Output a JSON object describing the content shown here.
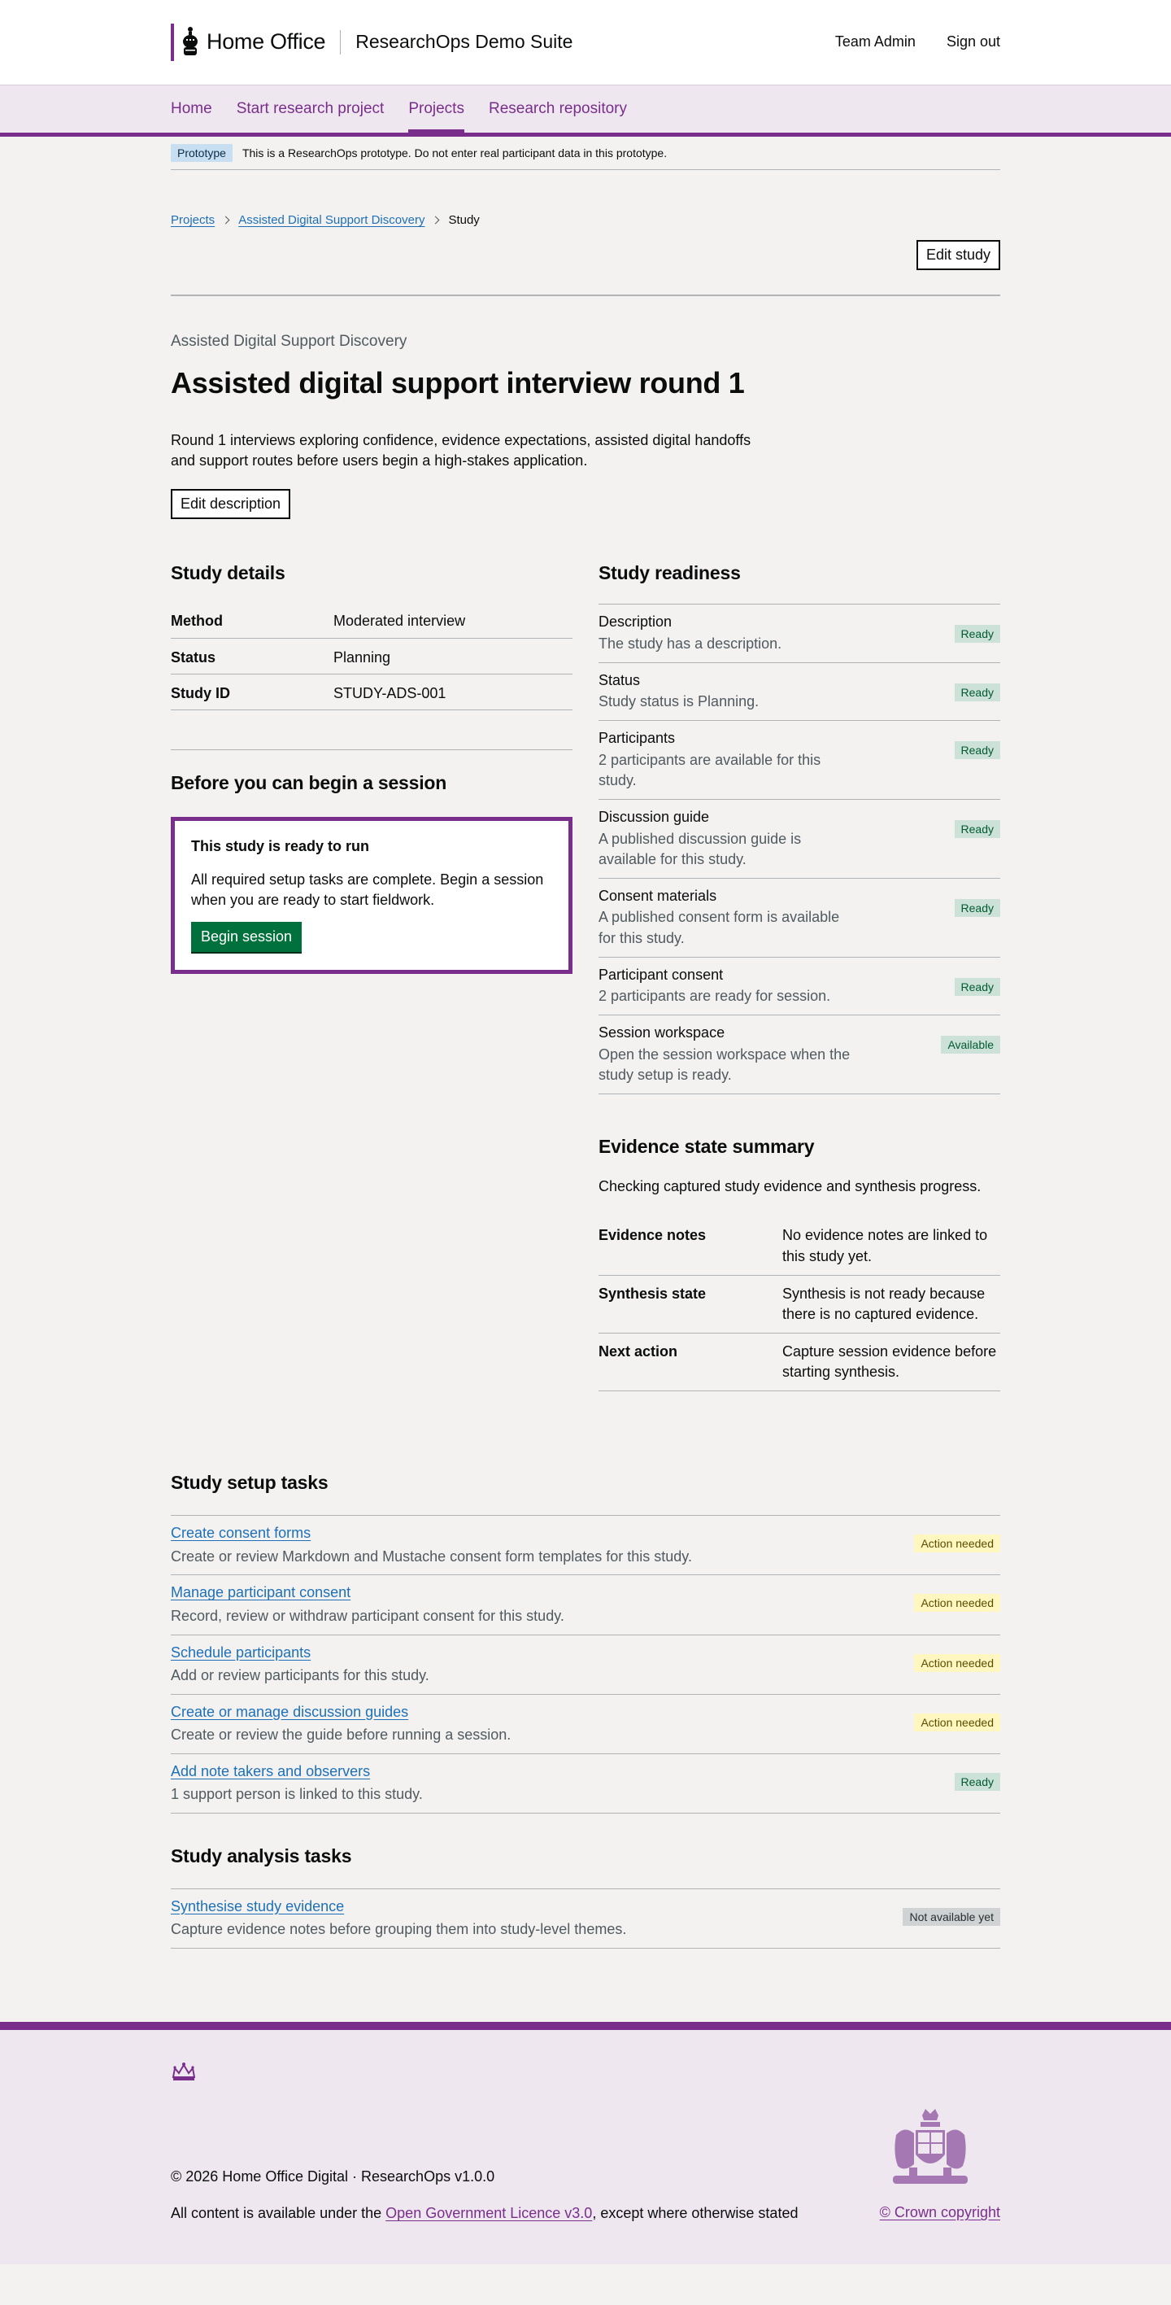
{
  "header": {
    "org": "Home Office",
    "service": "ResearchOps Demo Suite",
    "links": [
      "Team Admin",
      "Sign out"
    ]
  },
  "nav": {
    "items": [
      {
        "label": "Home",
        "active": false
      },
      {
        "label": "Start research project",
        "active": false
      },
      {
        "label": "Projects",
        "active": true
      },
      {
        "label": "Research repository",
        "active": false
      }
    ]
  },
  "phase": {
    "tag": "Prototype",
    "text": "This is a ResearchOps prototype. Do not enter real participant data in this prototype."
  },
  "breadcrumb": {
    "items": [
      "Projects",
      "Assisted Digital Support Discovery"
    ],
    "current": "Study"
  },
  "actions": {
    "edit_study": "Edit study",
    "edit_description": "Edit description"
  },
  "study": {
    "caption": "Assisted Digital Support Discovery",
    "title": "Assisted digital support interview round 1",
    "description": "Round 1 interviews exploring confidence, evidence expectations, assisted digital handoffs and support routes before users begin a high-stakes application."
  },
  "details": {
    "heading": "Study details",
    "rows": [
      {
        "key": "Method",
        "value": "Moderated interview"
      },
      {
        "key": "Status",
        "value": "Planning"
      },
      {
        "key": "Study ID",
        "value": "STUDY-ADS-001"
      }
    ]
  },
  "session": {
    "heading": "Before you can begin a session",
    "panel_title": "This study is ready to run",
    "panel_text": "All required setup tasks are complete. Begin a session when you are ready to start fieldwork.",
    "button": "Begin session"
  },
  "readiness": {
    "heading": "Study readiness",
    "rows": [
      {
        "name": "Description",
        "desc": "The study has a description.",
        "tag": "Ready"
      },
      {
        "name": "Status",
        "desc": "Study status is Planning.",
        "tag": "Ready"
      },
      {
        "name": "Participants",
        "desc": "2 participants are available for this study.",
        "tag": "Ready"
      },
      {
        "name": "Discussion guide",
        "desc": "A published discussion guide is available for this study.",
        "tag": "Ready"
      },
      {
        "name": "Consent materials",
        "desc": "A published consent form is available for this study.",
        "tag": "Ready"
      },
      {
        "name": "Participant consent",
        "desc": "2 participants are ready for session.",
        "tag": "Ready"
      },
      {
        "name": "Session workspace",
        "desc": "Open the session workspace when the study setup is ready.",
        "tag": "Available"
      }
    ]
  },
  "evidence": {
    "heading": "Evidence state summary",
    "intro": "Checking captured study evidence and synthesis progress.",
    "rows": [
      {
        "key": "Evidence notes",
        "value": "No evidence notes are linked to this study yet."
      },
      {
        "key": "Synthesis state",
        "value": "Synthesis is not ready because there is no captured evidence."
      },
      {
        "key": "Next action",
        "value": "Capture session evidence before starting synthesis."
      }
    ]
  },
  "setup_tasks": {
    "heading": "Study setup tasks",
    "rows": [
      {
        "link": "Create consent forms",
        "desc": "Create or review Markdown and Mustache consent form templates for this study.",
        "tag": "Action needed"
      },
      {
        "link": "Manage participant consent",
        "desc": "Record, review or withdraw participant consent for this study.",
        "tag": "Action needed"
      },
      {
        "link": "Schedule participants",
        "desc": "Add or review participants for this study.",
        "tag": "Action needed"
      },
      {
        "link": "Create or manage discussion guides",
        "desc": "Create or review the guide before running a session.",
        "tag": "Action needed"
      },
      {
        "link": "Add note takers and observers",
        "desc": "1 support person is linked to this study.",
        "tag": "Ready"
      }
    ]
  },
  "analysis_tasks": {
    "heading": "Study analysis tasks",
    "rows": [
      {
        "link": "Synthesise study evidence",
        "desc": "Capture evidence notes before grouping them into study-level themes.",
        "tag": "Not available yet"
      }
    ]
  },
  "footer": {
    "copyright_line": "© 2026 Home Office Digital · ResearchOps v1.0.0",
    "licence_prefix": "All content is available under the ",
    "licence_link": "Open Government Licence v3.0",
    "licence_suffix": ", except where otherwise stated",
    "crown_copyright": "© Crown copyright"
  },
  "colors": {
    "brand": "#7a2e8c",
    "link": "#1d70b8",
    "button_green": "#00703c",
    "tag_ready_bg": "#cce2d8",
    "tag_action_bg": "#fff7bf",
    "tag_unavailable_bg": "#d0d3d4"
  }
}
